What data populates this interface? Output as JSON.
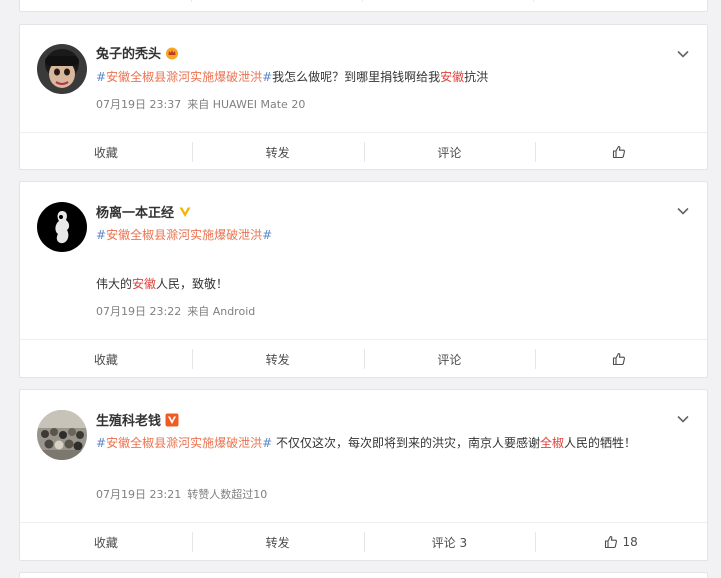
{
  "colors": {
    "topic": "#eb7350",
    "keyword": "#e0413d",
    "meta": "#808080",
    "text": "#333333",
    "page_bg": "#f2f2f5"
  },
  "posts": [
    {
      "author": "兔子的秃头",
      "badge_icon": "crown-badge-icon",
      "topic_hash_open": "#",
      "topic": "安徽全椒县滁河实施爆破泄洪",
      "topic_hash_close": "#",
      "text_a": "我怎么做呢？到哪里捐钱啊给我",
      "keyword": "安徽",
      "text_b": "抗洪",
      "time": "07月19日 23:37",
      "source": "来自 HUAWEI Mate 20",
      "actions": {
        "favorite": "收藏",
        "repost": "转发",
        "comment": "评论",
        "like_count": ""
      }
    },
    {
      "author": "杨离一本正经",
      "badge_icon": "verified-v-gold-icon",
      "topic_hash_open": "#",
      "topic": "安徽全椒县滁河实施爆破泄洪",
      "topic_hash_close": "#",
      "text_a": "伟大的",
      "keyword": "安徽",
      "text_b": "人民，致敬！",
      "time": "07月19日 23:22",
      "source": "来自 Android",
      "actions": {
        "favorite": "收藏",
        "repost": "转发",
        "comment": "评论",
        "like_count": ""
      }
    },
    {
      "author": "生殖科老钱",
      "badge_icon": "verified-v-orange-icon",
      "topic_hash_open": "#",
      "topic": "安徽全椒县滁河实施爆破泄洪",
      "topic_hash_close": "#",
      "text_a": " 不仅仅这次，每次即将到来的洪灾，南京人要感谢",
      "keyword": "全椒",
      "text_b": "人民的牺牲！",
      "time": "07月19日 23:21",
      "source": "转赞人数超过10",
      "actions": {
        "favorite": "收藏",
        "repost": "转发",
        "comment": "评论 3",
        "like_count": "18"
      }
    }
  ]
}
